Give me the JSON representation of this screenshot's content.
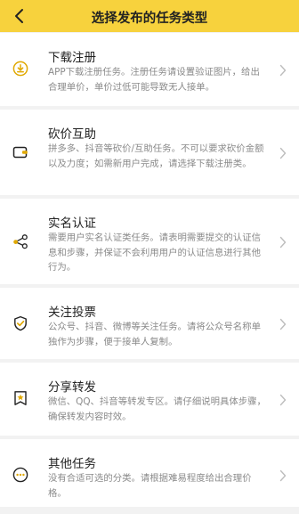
{
  "header": {
    "title": "选择发布的任务类型",
    "background_color": "#f7d23d",
    "back_icon": "chevron-left-icon"
  },
  "accent_color": "#e0a800",
  "items": [
    {
      "icon": "download-icon",
      "title": "下载注册",
      "desc": "APP下载注册任务。注册任务请设置验证图片，给出合理单价，单价过低可能导致无人接单。"
    },
    {
      "icon": "wallet-icon",
      "title": "砍价互助",
      "desc": "拼多多、抖音等砍价/互助任务。不可以要求砍价金额以及力度；如需新用户完成，请选择下载注册类。"
    },
    {
      "icon": "share-nodes-icon",
      "title": "实名认证",
      "desc": "需要用户实名认证类任务。请表明需要提交的认证信息和步骤，并保证不会利用用户的认证信息进行其他行为。"
    },
    {
      "icon": "shield-check-icon",
      "title": "关注投票",
      "desc": "公众号、抖音、微博等关注任务。请将公众号名称单独作为步骤，便于接单人复制。"
    },
    {
      "icon": "star-doc-icon",
      "title": "分享转发",
      "desc": "微信、QQ、抖音等转发专区。请仔细说明具体步骤，确保转发内容时效。"
    },
    {
      "icon": "more-circle-icon",
      "title": "其他任务",
      "desc": "没有合适可选的分类。请根据难易程度给出合理价格。"
    }
  ]
}
